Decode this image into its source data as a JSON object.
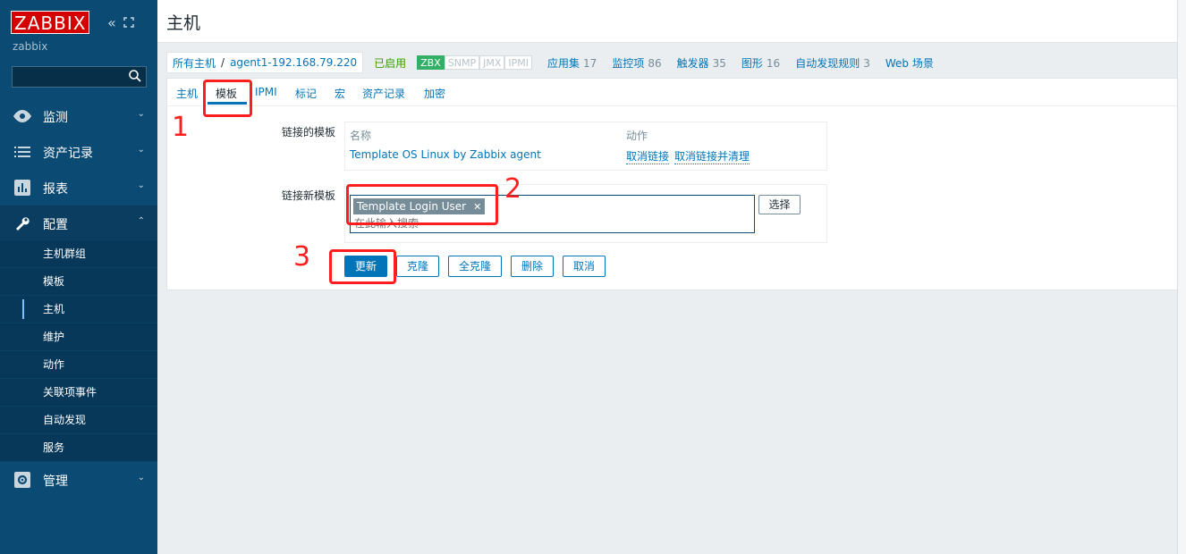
{
  "sidebar": {
    "logo": "ZABBIX",
    "server_name": "zabbix",
    "search_placeholder": "",
    "nav": [
      {
        "label": "监测",
        "icon": "eye-icon"
      },
      {
        "label": "资产记录",
        "icon": "list-icon"
      },
      {
        "label": "报表",
        "icon": "bar-chart-icon"
      },
      {
        "label": "配置",
        "icon": "wrench-icon"
      },
      {
        "label": "管理",
        "icon": "gear-icon"
      }
    ],
    "submenu": [
      "主机群组",
      "模板",
      "主机",
      "维护",
      "动作",
      "关联项事件",
      "自动发现",
      "服务"
    ]
  },
  "header": {
    "title": "主机"
  },
  "breadcrumb": {
    "all_hosts": "所有主机",
    "sep": "/",
    "host": "agent1-192.168.79.220",
    "status": "已启用",
    "availability": [
      "ZBX",
      "SNMP",
      "JMX",
      "IPMI"
    ],
    "links": [
      {
        "label": "应用集",
        "count": "17"
      },
      {
        "label": "监控项",
        "count": "86"
      },
      {
        "label": "触发器",
        "count": "35"
      },
      {
        "label": "图形",
        "count": "16"
      },
      {
        "label": "自动发现规则",
        "count": "3"
      },
      {
        "label": "Web 场景",
        "count": ""
      }
    ]
  },
  "tabs": [
    "主机",
    "模板",
    "IPMI",
    "标记",
    "宏",
    "资产记录",
    "加密"
  ],
  "form": {
    "linked_label": "链接的模板",
    "col_name": "名称",
    "col_action": "动作",
    "linked_template": "Template OS Linux by Zabbix agent",
    "unlink": "取消链接",
    "unlink_clear": "取消链接并清理",
    "new_label": "链接新模板",
    "chip": "Template Login User",
    "input_placeholder": "在此输入搜索",
    "select_btn": "选择"
  },
  "buttons": [
    "更新",
    "克隆",
    "全克隆",
    "删除",
    "取消"
  ],
  "annotations": [
    "1",
    "2",
    "3"
  ],
  "colors": {
    "sidebar": "#0b4a73",
    "accent": "#0275b8",
    "annotation": "#ff1d1d",
    "zbx_available": "#34af67"
  }
}
